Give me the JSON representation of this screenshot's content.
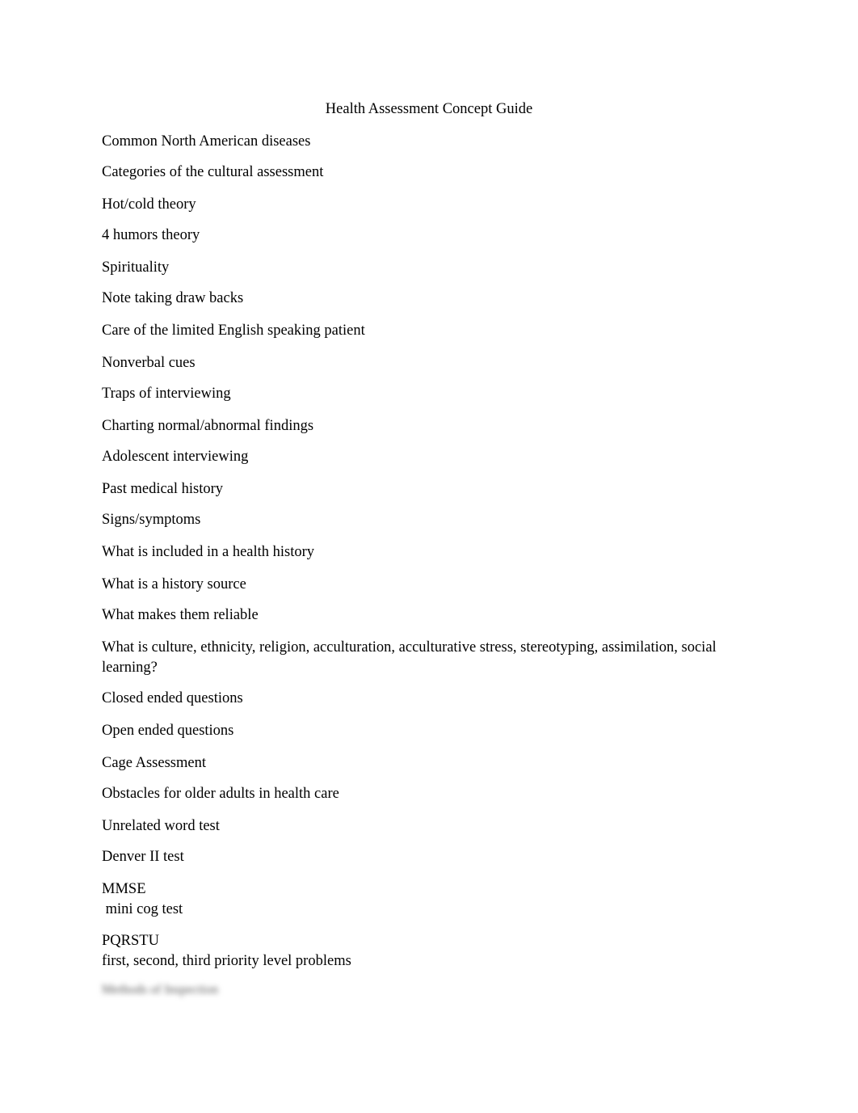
{
  "document": {
    "title": "Health Assessment Concept Guide",
    "items": [
      "Common North American diseases",
      "Categories of the cultural assessment",
      "Hot/cold theory",
      "4 humors theory",
      "Spirituality",
      "Note taking draw backs",
      "Care of the limited English speaking patient",
      "Nonverbal cues",
      "Traps of interviewing",
      "Charting normal/abnormal findings",
      "Adolescent interviewing",
      "Past medical history",
      "Signs/symptoms",
      "What is included in a health history",
      "What is a history source",
      "What makes them reliable",
      "What is culture, ethnicity, religion, acculturation, acculturative stress, stereotyping, assimilation, social\nlearning?",
      "Closed ended questions",
      "Open ended questions",
      "Cage Assessment",
      "Obstacles for older adults in health care",
      "Unrelated word test",
      "Denver II test",
      "MMSE\n mini cog test",
      "PQRSTU\nfirst, second, third priority level problems"
    ],
    "blurred_line": "Methods of Inspection"
  }
}
